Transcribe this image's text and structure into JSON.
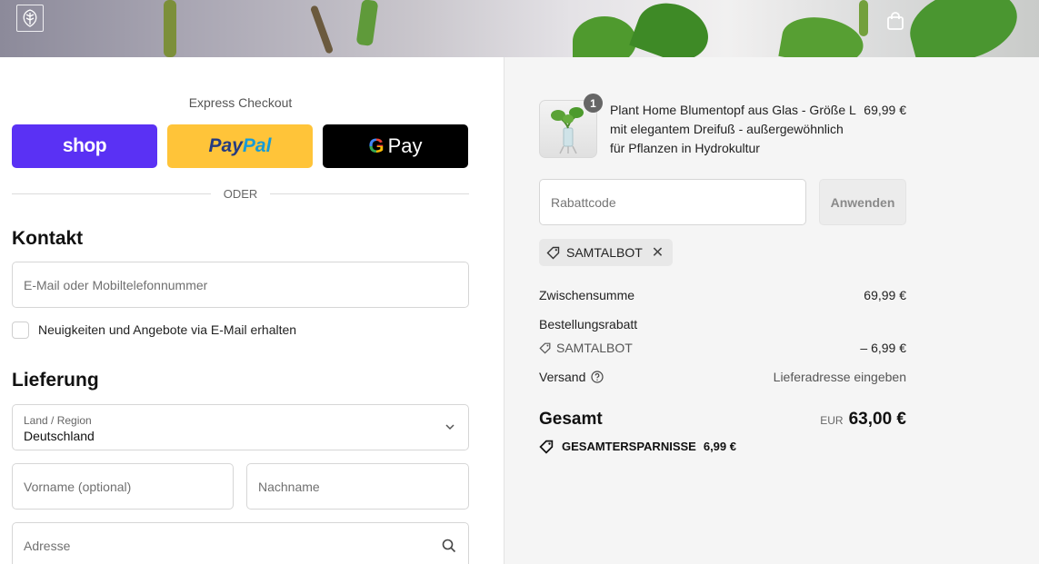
{
  "header": {
    "logo_icon": "monstera-leaf-logo-icon",
    "cart_icon": "shopping-bag-icon"
  },
  "express": {
    "title": "Express Checkout",
    "shop_label": "shop",
    "paypal_label_1": "Pay",
    "paypal_label_2": "Pal",
    "gpay_g": "G",
    "gpay_label": "Pay",
    "divider": "ODER"
  },
  "contact": {
    "title": "Kontakt",
    "email_placeholder": "E-Mail oder Mobiltelefonnummer",
    "newsletter_label": "Neuigkeiten und Angebote via E-Mail erhalten"
  },
  "delivery": {
    "title": "Lieferung",
    "country_label": "Land / Region",
    "country_value": "Deutschland",
    "firstname_placeholder": "Vorname (optional)",
    "lastname_placeholder": "Nachname",
    "address_placeholder": "Adresse"
  },
  "summary": {
    "item": {
      "quantity": "1",
      "name": "Plant Home Blumentopf aus Glas - Größe L mit elegantem Dreifuß - außergewöhnlich für Pflanzen in Hydrokultur",
      "price": "69,99 €"
    },
    "discount_placeholder": "Rabattcode",
    "apply_label": "Anwenden",
    "applied_code": "SAMTALBOT",
    "remove_symbol": "✕",
    "subtotal_label": "Zwischensumme",
    "subtotal_value": "69,99 €",
    "order_discount_label": "Bestellungsrabatt",
    "discount_code": "SAMTALBOT",
    "discount_value": "– 6,99 €",
    "shipping_label": "Versand",
    "shipping_value": "Lieferadresse eingeben",
    "total_label": "Gesamt",
    "currency": "EUR",
    "total_value": "63,00 €",
    "savings_label": "GESAMTERSPARNISSE",
    "savings_value": "6,99 €"
  },
  "colors": {
    "shop": "#5a31f4",
    "paypal": "#ffc439",
    "gpay": "#000000",
    "summary_bg": "#f5f5f5"
  }
}
